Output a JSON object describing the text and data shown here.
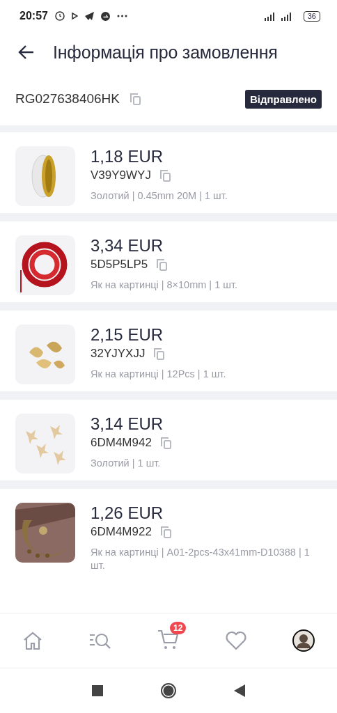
{
  "status_bar": {
    "time": "20:57",
    "battery": "36"
  },
  "header": {
    "title": "Інформація про замовлення"
  },
  "order": {
    "number": "RG027638406HK",
    "status": "Відправлено"
  },
  "items": [
    {
      "price": "1,18 EUR",
      "sku": "V39Y9WYJ",
      "details": "Золотий | 0.45mm 20M | 1 шт."
    },
    {
      "price": "3,34 EUR",
      "sku": "5D5P5LP5",
      "details": "Як на картинці | 8×10mm | 1 шт."
    },
    {
      "price": "2,15 EUR",
      "sku": "32YJYXJJ",
      "details": "Як на картинці | 12Pcs | 1 шт."
    },
    {
      "price": "3,14 EUR",
      "sku": "6DM4M942",
      "details": "Золотий | 1 шт."
    },
    {
      "price": "1,26 EUR",
      "sku": "6DM4M922",
      "details": "Як на картинці | A01-2pcs-43x41mm-D10388 | 1 шт."
    }
  ],
  "bottom_nav": {
    "cart_badge": "12"
  }
}
